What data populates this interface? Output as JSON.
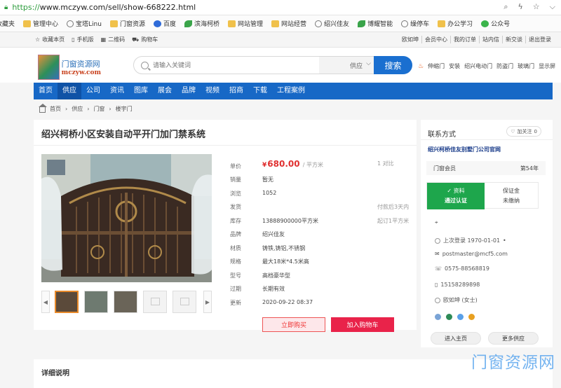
{
  "browser": {
    "url_protocol": "https://",
    "url_rest": "www.mczyw.com/sell/show-668222.html",
    "bookmarks": [
      {
        "label": "收藏夹",
        "icon": "none"
      },
      {
        "label": "管理中心",
        "icon": "folder"
      },
      {
        "label": "宝塔Linu",
        "icon": "globe"
      },
      {
        "label": "门窗资源",
        "icon": "folder"
      },
      {
        "label": "百度",
        "icon": "paw"
      },
      {
        "label": "滨海柯桥",
        "icon": "leaf"
      },
      {
        "label": "网站管理",
        "icon": "folder"
      },
      {
        "label": "网站经营",
        "icon": "folder"
      },
      {
        "label": "绍兴佳友",
        "icon": "globe"
      },
      {
        "label": "博耀智能",
        "icon": "leaf"
      },
      {
        "label": "缲停车",
        "icon": "globe"
      },
      {
        "label": "办公学习",
        "icon": "folder"
      },
      {
        "label": "公众号",
        "icon": "green"
      }
    ]
  },
  "topnav": {
    "left": [
      "收藏本页",
      "手机版",
      "二维码",
      "购物车"
    ],
    "right": [
      "欧如坤",
      "会员中心",
      "我的订单",
      "站内信",
      "新交谈",
      "退出登录"
    ]
  },
  "header": {
    "logo_cn": "门窗资源网",
    "logo_en": "mczyw.com",
    "search_placeholder": "请输入关键词",
    "search_type": "供应",
    "search_button": "搜索",
    "hotwords": [
      "伸缩门",
      "安装",
      "绍兴电动门",
      "防盗门",
      "玻璃门",
      "显示屏"
    ]
  },
  "mainnav": [
    "首页",
    "供应",
    "公司",
    "资讯",
    "图库",
    "展会",
    "品牌",
    "视频",
    "招商",
    "下载",
    "工程案例"
  ],
  "breadcrumb": [
    "首页",
    "供应",
    "门窗",
    "楼宇门"
  ],
  "product": {
    "title": "绍兴柯桥小区安装自动平开门加门禁系统",
    "price_label": "单价",
    "price_symbol": "¥",
    "price": "680.00",
    "price_unit": "/ 平方米",
    "price_note": "1",
    "price_compare": "对比",
    "specs": [
      {
        "k": "销量",
        "v": "暂无",
        "r": ""
      },
      {
        "k": "浏览",
        "v": "1052",
        "r": ""
      },
      {
        "k": "发货",
        "v": "",
        "r": "付款后3天内"
      },
      {
        "k": "库存",
        "v": "13888900000平方米",
        "r": "起订1平方米"
      },
      {
        "k": "品牌",
        "v": "绍兴佳友",
        "r": ""
      },
      {
        "k": "材质",
        "v": "铸铁,铸铝,不锈钢",
        "r": ""
      },
      {
        "k": "规格",
        "v": "最大18米*4.5米高",
        "r": ""
      },
      {
        "k": "型号",
        "v": "高档豪华型",
        "r": ""
      },
      {
        "k": "过期",
        "v": "长期有效",
        "r": ""
      },
      {
        "k": "更新",
        "v": "2020-09-22 08:37",
        "r": ""
      }
    ],
    "buy_button": "立即购买",
    "cart_button": "加入购物车"
  },
  "seller": {
    "title": "联系方式",
    "fav_label": "加关注",
    "fav_count": "0",
    "company": "绍兴柯桥佳友别墅门公司官网",
    "member_label": "门窗会员",
    "member_years": "第54年",
    "verified_l1": "✓ 资料",
    "verified_l2": "通过认证",
    "deposit_l1": "保证金",
    "deposit_l2": "未缴纳",
    "last_login": "上次登录 1970-01-01",
    "email": "postmaster@mcf5.com",
    "phone": "0575-88568819",
    "mobile": "15158289898",
    "contact": "欧如坤 (女士)",
    "home_button": "进入主页",
    "more_button": "更多供应"
  },
  "detail_title": "详细说明",
  "watermark": "门窗资源网"
}
